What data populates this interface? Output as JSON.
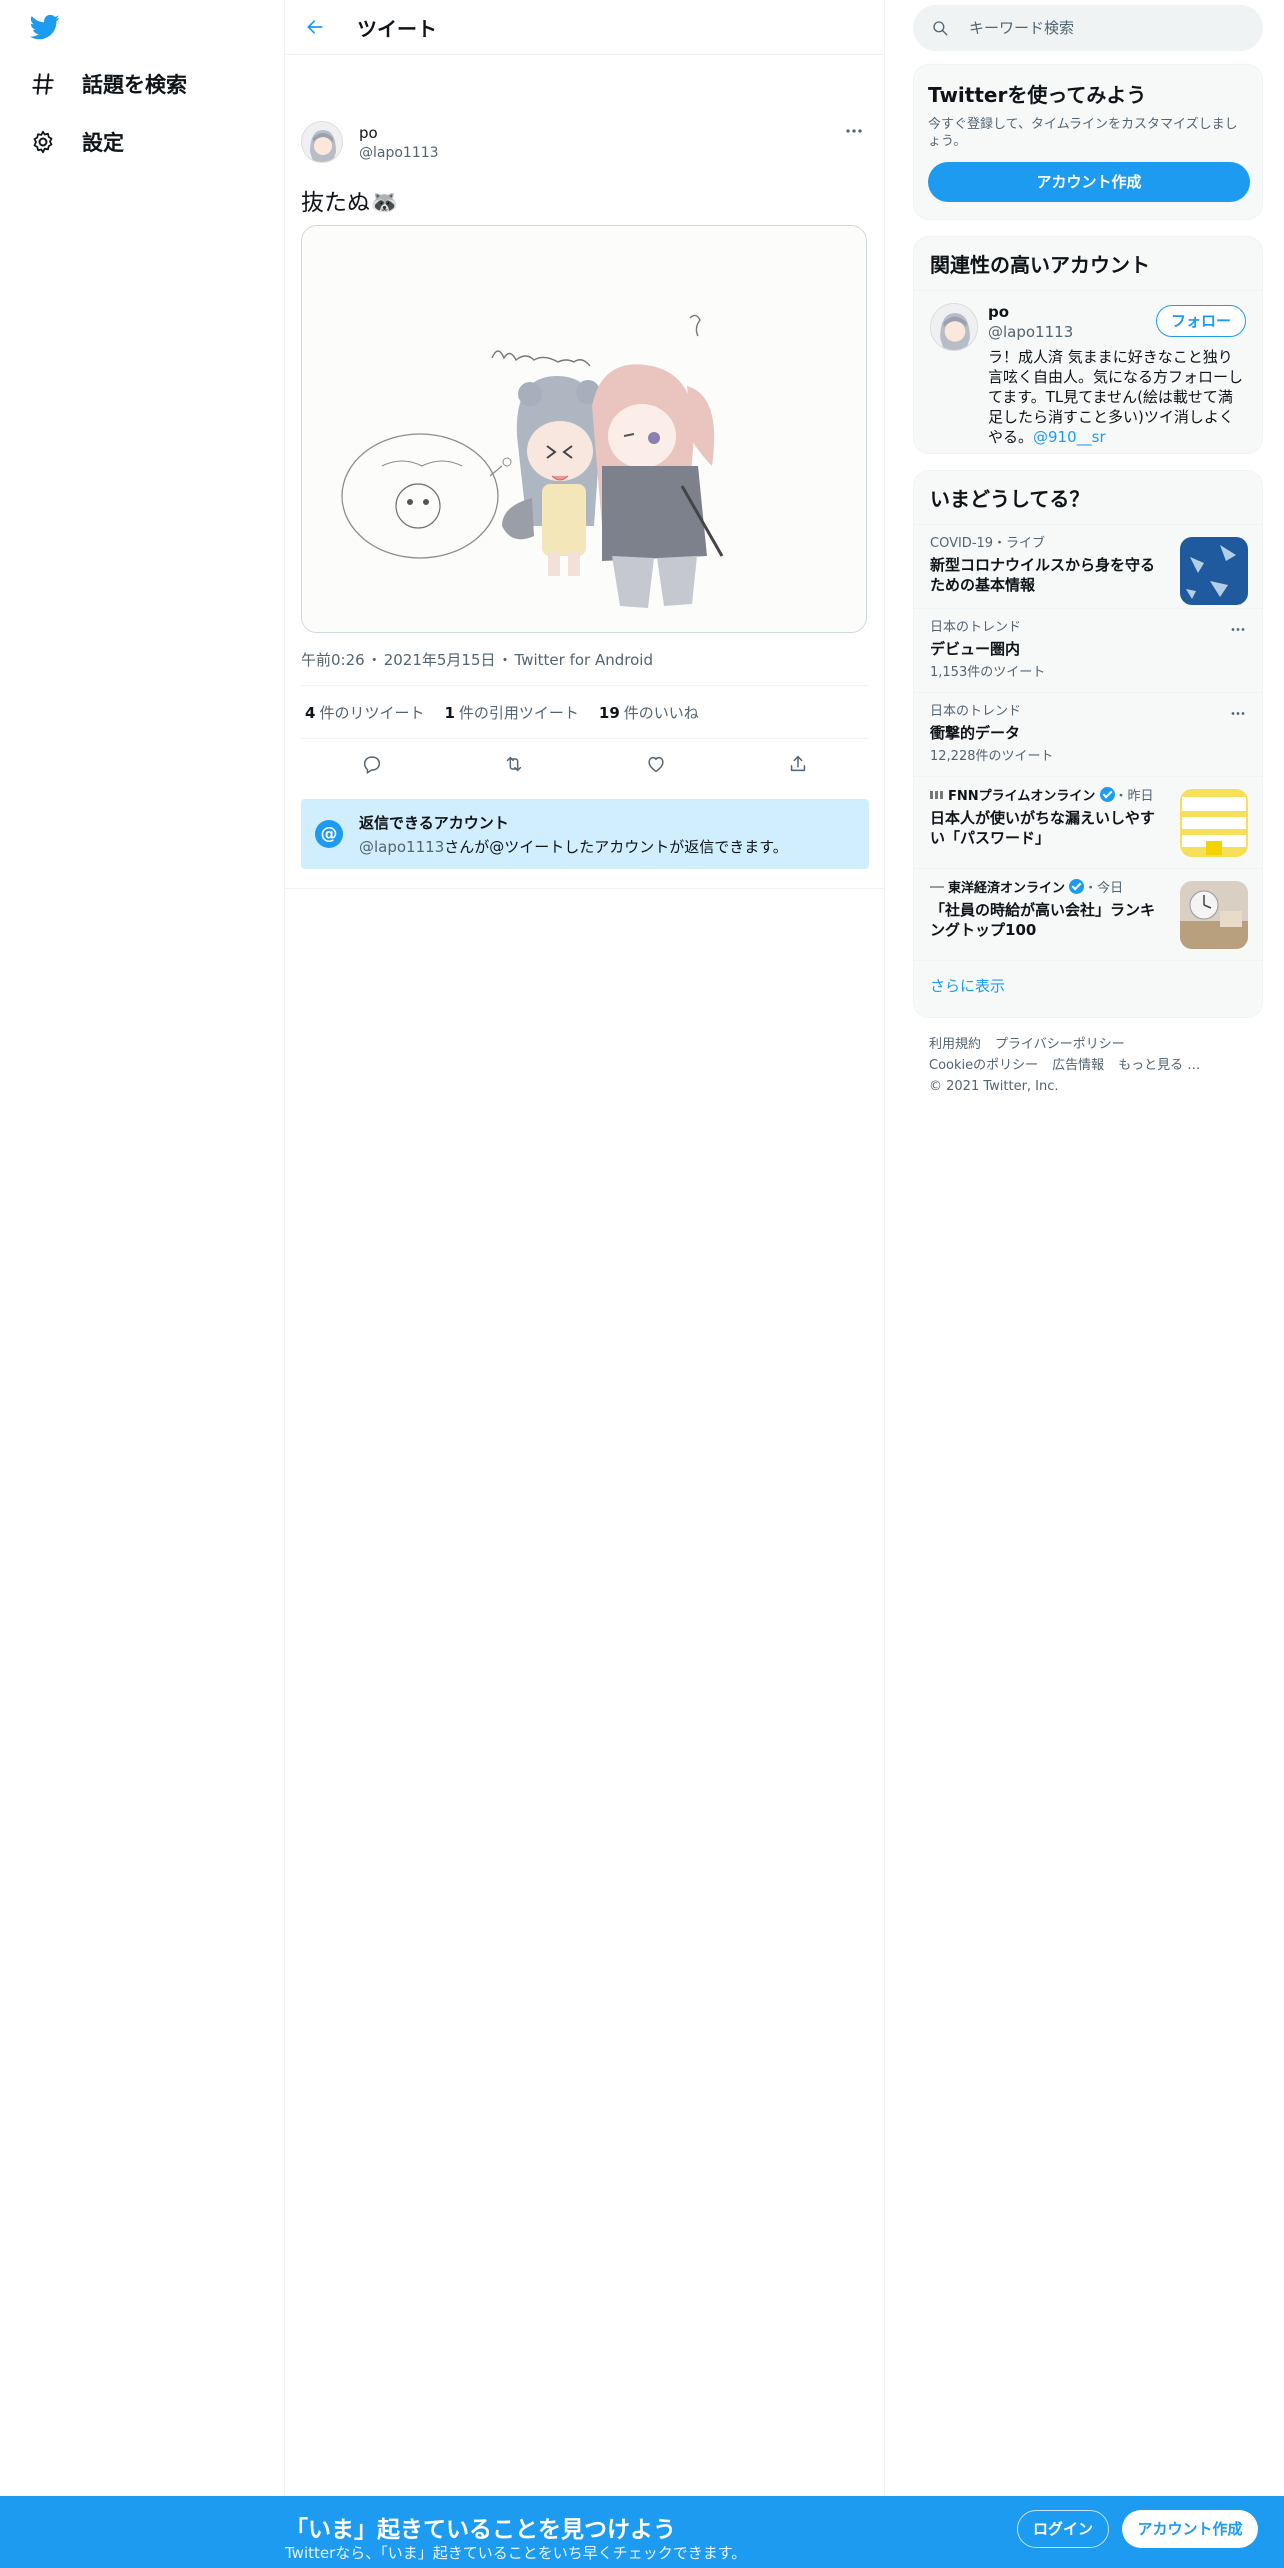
{
  "nav": {
    "logo": "twitter-bird-icon",
    "items": [
      {
        "label": "話題を検索",
        "icon": "hashtag-icon"
      },
      {
        "label": "設定",
        "icon": "gear-icon"
      }
    ]
  },
  "header": {
    "title": "ツイート",
    "back_icon": "arrow-left-icon"
  },
  "tweet": {
    "author_name": "po",
    "author_handle": "@lapo1113",
    "text": "抜たぬ🦝",
    "media_alt": "illustration",
    "time": "午前0:26",
    "date": "2021年5月15日",
    "client": "Twitter for Android",
    "sep": "・",
    "stats": [
      {
        "count": "4",
        "label": "件のリツイート"
      },
      {
        "count": "1",
        "label": "件の引用ツイート"
      },
      {
        "count": "19",
        "label": "件のいいね"
      }
    ],
    "actions": [
      "reply-icon",
      "retweet-icon",
      "like-icon",
      "share-icon"
    ]
  },
  "reply_notice": {
    "icon_text": "@",
    "title": "返信できるアカウント",
    "handle": "@lapo1113",
    "desc": "さんが@ツイートしたアカウントが返信できます。"
  },
  "search": {
    "placeholder": "キーワード検索"
  },
  "signup_card": {
    "title": "Twitterを使ってみよう",
    "desc": "今すぐ登録して、タイムラインをカスタマイズしましょう。",
    "button": "アカウント作成"
  },
  "related": {
    "title": "関連性の高いアカウント",
    "name": "po",
    "handle": "@lapo1113",
    "follow": "フォロー",
    "bio": "ラ！成人済 気ままに好きなこと独り言呟く自由人。気になる方フォローしてます。TL見てません(絵は載せて満足したら消すこと多い)ツイ消しよくやる。",
    "bio_link": "@910__sr"
  },
  "trends": {
    "title": "いまどうしてる？",
    "items": [
      {
        "meta": "COVID-19・ライブ",
        "title": "新型コロナウイルスから身を守るための基本情報"
      },
      {
        "meta": "日本のトレンド",
        "title": "デビュー圏内",
        "count": "1,153件のツイート"
      },
      {
        "meta": "日本のトレンド",
        "title": "衝撃的データ",
        "count": "12,228件のツイート"
      },
      {
        "source": "FNNプライムオンライン",
        "time": "・昨日",
        "title": "日本人が使いがちな漏えいしやすい「パスワード」"
      },
      {
        "source": "東洋経済オンライン",
        "time": "・今日",
        "title": "「社員の時給が高い会社」ランキングトップ100"
      }
    ],
    "show_more": "さらに表示"
  },
  "footer": {
    "links": [
      "利用規約",
      "プライバシーポリシー",
      "Cookieのポリシー",
      "広告情報",
      "もっと見る …"
    ],
    "copyright": "© 2021 Twitter, Inc."
  },
  "bottom_bar": {
    "title": "「いま」起きていることを見つけよう",
    "subtitle": "Twitterなら、「いま」起きていることをいち早くチェックできます。",
    "login": "ログイン",
    "signup": "アカウント作成"
  },
  "colors": {
    "accent": "#1d9bf0",
    "text": "#0f1419",
    "muted": "#536471"
  }
}
